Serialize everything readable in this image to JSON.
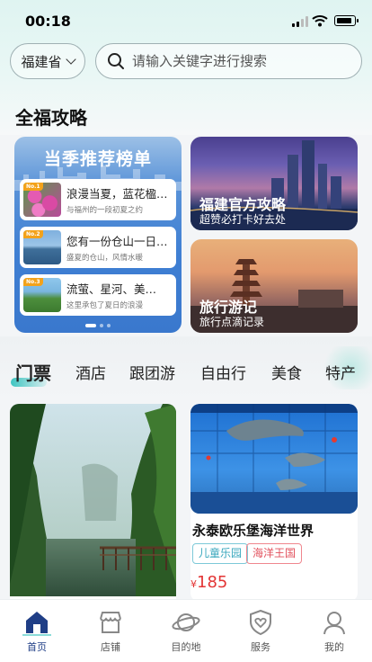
{
  "status_bar": {
    "time": "00:18"
  },
  "header": {
    "province": "福建省",
    "search_placeholder": "请输入关键字进行搜索"
  },
  "guide": {
    "title": "全福攻略",
    "ranking": {
      "title": "当季推荐榜单",
      "items": [
        {
          "badge": "No.1",
          "title": "浪漫当夏，蓝花楹…",
          "subtitle": "与福州的一段初夏之约"
        },
        {
          "badge": "No.2",
          "title": "您有一份仓山一日…",
          "subtitle": "盛夏的仓山，风情水暖"
        },
        {
          "badge": "No.3",
          "title": "流萤、星河、美…",
          "subtitle": "这里承包了夏日的浪漫"
        }
      ]
    },
    "promos": [
      {
        "title": "福建官方攻略",
        "subtitle": "超赞必打卡好去处"
      },
      {
        "title": "旅行游记",
        "subtitle": "旅行点滴记录"
      }
    ]
  },
  "category_tabs": [
    "门票",
    "酒店",
    "跟团游",
    "自由行",
    "美食",
    "特产"
  ],
  "products": [
    {
      "title": "永泰欧乐堡海洋世界",
      "tags": [
        "儿童乐园",
        "海洋王国"
      ],
      "currency": "¥",
      "price": "185"
    }
  ],
  "bottom_nav": [
    {
      "label": "首页",
      "icon": "home-icon",
      "active": true
    },
    {
      "label": "店铺",
      "icon": "store-icon",
      "active": false
    },
    {
      "label": "目的地",
      "icon": "planet-icon",
      "active": false
    },
    {
      "label": "服务",
      "icon": "shield-heart-icon",
      "active": false
    },
    {
      "label": "我的",
      "icon": "user-icon",
      "active": false
    }
  ],
  "colors": {
    "accent": "#1f3e86",
    "price": "#e33535",
    "tab_underline": "#3fc5c1"
  }
}
